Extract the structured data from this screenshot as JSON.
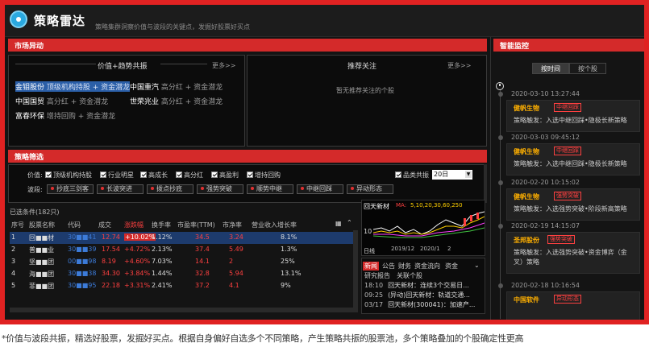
{
  "app": {
    "title": "策略雷达",
    "subtitle": "策略集群洞察价值与波段的关键点，发掘好股票好买点"
  },
  "market": {
    "header": "市场异动",
    "left_box": {
      "title": "价值+趋势共振",
      "more": "更多>>",
      "items": [
        {
          "name": "金钼股份",
          "tags": "顶级机构持股 + 资金潜龙"
        },
        {
          "name": "中国重汽",
          "tags": "高分红 + 资金潜龙"
        },
        {
          "name": "中国国贸",
          "tags": "高分红 + 资金潜龙"
        },
        {
          "name": "世荣兆业",
          "tags": "高分红 + 资金潜龙"
        },
        {
          "name": "富春环保",
          "tags": "增持回购 + 资金潜龙"
        }
      ]
    },
    "right_box": {
      "title": "推荐关注",
      "more": "更多>>",
      "empty": "暂无推荐关注的个股"
    }
  },
  "filter": {
    "header": "策略筛选",
    "value_label": "价值:",
    "value_checks": [
      "顶级机构持股",
      "行业明星",
      "高成长",
      "高分红",
      "高盈利",
      "增持回购"
    ],
    "only_label": "品类共振",
    "date": "20日",
    "band_label": "波段:",
    "band_selects": [
      "抄底三剑客",
      "长波突进",
      "拨点抄底",
      "强势突破",
      "顺势中继",
      "中继回踩",
      "异动形态"
    ]
  },
  "table": {
    "condition": "已选条件(182只)",
    "headers": [
      "序号",
      "股票名称",
      "代码",
      "成交",
      "涨跌幅",
      "换手率",
      "市盈率(TTM)",
      "市净率",
      "营业收入增长率"
    ],
    "rows": [
      {
        "no": "1",
        "name": "回■■材",
        "code": "30■■41",
        "price": "12.74",
        "chg": "+10.02%",
        "turn": "1.12%",
        "pe": "34.5",
        "pb": "3.24",
        "growth": "8.1%"
      },
      {
        "no": "2",
        "name": "普■■业",
        "code": "30■■39",
        "price": "17.54",
        "chg": "+4.72%",
        "turn": "2.13%",
        "pe": "37.4",
        "pb": "5.49",
        "growth": "1.3%"
      },
      {
        "no": "3",
        "name": "坚■■团",
        "code": "00■■98",
        "price": "8.19",
        "chg": "+4.60%",
        "turn": "7.03%",
        "pe": "14.1",
        "pb": "2",
        "growth": "25%"
      },
      {
        "no": "4",
        "name": "海■■团",
        "code": "30■■38",
        "price": "34.30",
        "chg": "+3.84%",
        "turn": "1.44%",
        "pe": "32.8",
        "pb": "5.94",
        "growth": "13.1%"
      },
      {
        "no": "5",
        "name": "菲■■团",
        "code": "30■■95",
        "price": "22.18",
        "chg": "+3.31%",
        "turn": "2.41%",
        "pe": "37.2",
        "pb": "4.1",
        "growth": "9%"
      }
    ]
  },
  "mini_chart": {
    "name": "回天新材",
    "ma": "MA:",
    "ma_values": "5,10,20,30,60,250",
    "y_label": "10",
    "x_labels": [
      "2019/12",
      "2020/1",
      "2"
    ],
    "period": "日线"
  },
  "news": {
    "tabs": [
      "新闻",
      "公告",
      "财务",
      "资金流向",
      "资金"
    ],
    "subtabs": [
      "研究报告",
      "关联个股"
    ],
    "items": [
      {
        "time": "18:10",
        "text": "回天新材：连续3个交易日..."
      },
      {
        "time": "09:25",
        "text": "(异动)回天新材：轨道交通..."
      },
      {
        "time": "03/17",
        "text": "回天新材(300041)：加速产..."
      }
    ]
  },
  "monitor": {
    "header": "智能监控",
    "tabs": [
      "按时间",
      "按个股"
    ],
    "events": [
      {
        "time": "2020-03-10 13:27:44",
        "stock": "健帆生物",
        "badge": "中继回踩",
        "desc": "策略触发：入选中继回踩•隐极长新策略"
      },
      {
        "time": "2020-03-03 09:45:12",
        "stock": "健帆生物",
        "badge": "中继回踩",
        "desc": "策略触发：入选中继回踩•隐极长新策略"
      },
      {
        "time": "2020-02-20 10:15:02",
        "stock": "健帆生物",
        "badge": "强势突破",
        "desc": "策略触发：入选强势突破•阶段新高策略"
      },
      {
        "time": "2020-02-19 14:15:07",
        "stock": "圣邦股份",
        "badge": "强势突破",
        "desc": "策略触发：入选强势突破•资金博弈（金叉）策略"
      },
      {
        "time": "2020-02-18 10:16:54",
        "stock": "中国软件",
        "badge": "异动形态",
        "desc": ""
      }
    ]
  },
  "caption": "*价值与波段共振，精选好股票，发掘好买点。根据自身偏好自选多个不同策略，产生策略共振的股票池，多个策略叠加的个股确定性更高"
}
